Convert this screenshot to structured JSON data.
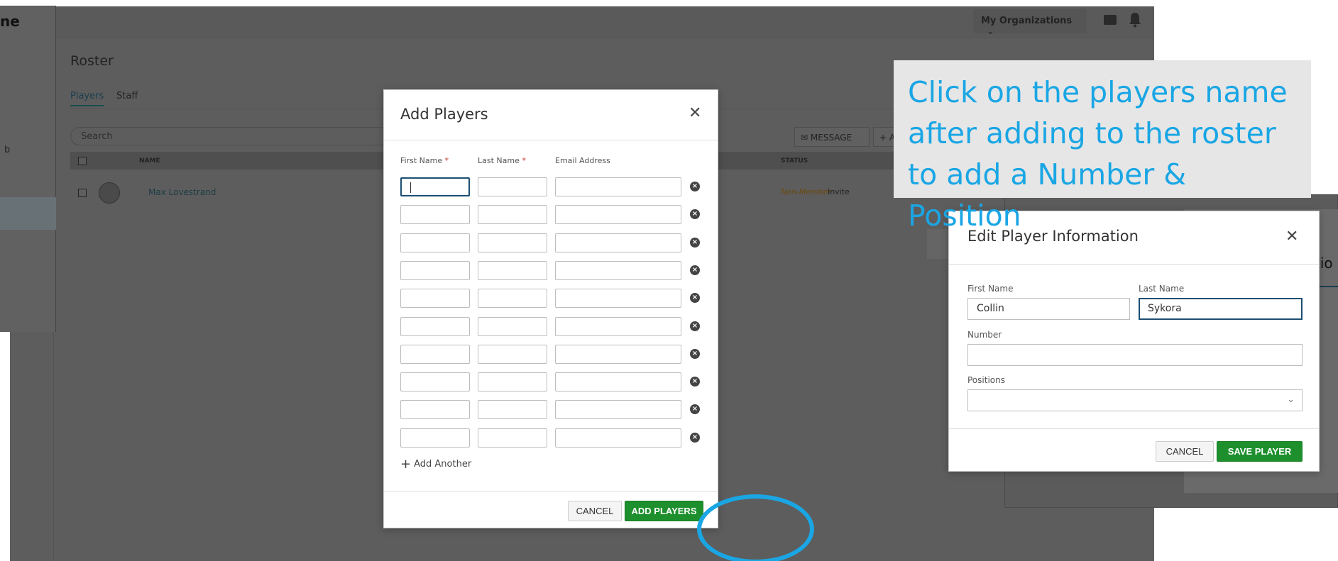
{
  "app": {
    "logo_fragment": "ne",
    "org_button_label": "My Organizations",
    "left_fragment_text": "b",
    "page_title": "Roster",
    "tabs": [
      {
        "label": "Players"
      },
      {
        "label": "Staff"
      }
    ],
    "search_placeholder": "Search",
    "message_button": "MESSAGE",
    "add_button": "AD",
    "table_headers": {
      "name": "NAME",
      "status": "STATUS"
    },
    "rows": [
      {
        "name": "Max Lovestrand",
        "status": "Non-Member",
        "action": "Invite"
      }
    ],
    "right_fragment_text": "tio"
  },
  "add_players_modal": {
    "title": "Add Players",
    "columns": {
      "first_name": "First Name",
      "last_name": "Last Name",
      "email": "Email Address"
    },
    "required_mark": "*",
    "row_count": 10,
    "add_another_label": "Add Another",
    "cancel_label": "CANCEL",
    "submit_label": "ADD PLAYERS"
  },
  "edit_player_modal": {
    "title": "Edit Player Information",
    "first_name_label": "First Name",
    "first_name_value": "Collin",
    "last_name_label": "Last Name",
    "last_name_value": "Sykora",
    "number_label": "Number",
    "number_value": "",
    "positions_label": "Positions",
    "positions_value": "",
    "cancel_label": "CANCEL",
    "save_label": "SAVE PLAYER"
  },
  "callout": {
    "text": "Click on the players name after adding to the roster to add a Number & Position",
    "color": "#1aa6e4"
  },
  "colors": {
    "accent_green": "#1e8f2d",
    "focus_border": "#1d4f73",
    "highlight": "#1aa6e4"
  }
}
